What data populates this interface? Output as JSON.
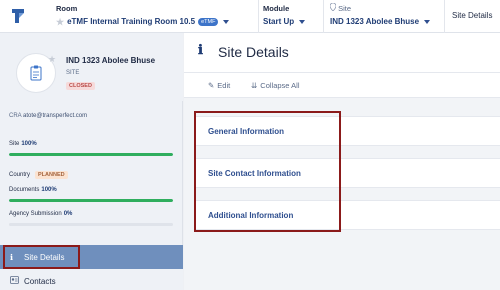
{
  "header": {
    "room_label": "Room",
    "room_value": "eTMF Internal Training Room 10.5",
    "room_badge": "eTMF",
    "module_label": "Module",
    "module_value": "Start Up",
    "site_label": "Site",
    "site_value": "IND 1323 Abolee Bhuse",
    "current_page": "Site Details"
  },
  "site_card": {
    "name": "IND 1323 Abolee Bhuse",
    "type": "SITE",
    "status": "CLOSED"
  },
  "cra": {
    "label": "CRA",
    "email": "atote@transperfect.com"
  },
  "metrics": {
    "site_label": "Site",
    "site_pct": "100%",
    "site_progress": 1.0,
    "country_label": "Country",
    "country_status": "PLANNED",
    "documents_label": "Documents",
    "documents_pct": "100%",
    "documents_progress": 1.0,
    "agency_label": "Agency Submission",
    "agency_pct": "0%",
    "agency_progress": 0.0
  },
  "nav": {
    "site_details": "Site Details",
    "contacts": "Contacts"
  },
  "main": {
    "title": "Site Details",
    "edit_label": "Edit",
    "collapse_label": "Collapse All",
    "sections": [
      "General Information",
      "Site Contact Information",
      "Additional Information"
    ]
  },
  "colors": {
    "accent": "#1f3c74",
    "progress": "#2fae5e",
    "highlight": "#8b1a1a",
    "nav_active": "#6f8fbd"
  },
  "icons": {
    "logo": "brand-logo-icon",
    "favorite": "star-icon",
    "site": "location-pin-icon",
    "info": "info-icon",
    "edit": "pencil-icon",
    "collapse": "collapse-icon",
    "contacts": "contacts-icon",
    "avatar": "clipboard-icon"
  }
}
